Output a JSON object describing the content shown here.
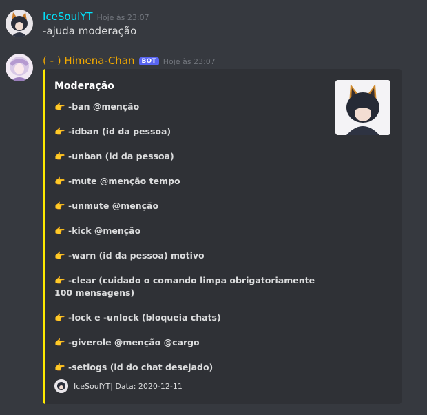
{
  "messages": [
    {
      "author": "IceSoulYT",
      "author_color": "#00e5ff",
      "timestamp": "Hoje às 23:07",
      "content": "-ajuda moderação"
    },
    {
      "author": "( - ) Himena-Chan",
      "author_color": "#f2a900",
      "badge": "BOT",
      "timestamp": "Hoje às 23:07",
      "embed": {
        "accent_color": "#ffea00",
        "title": "Moderação",
        "pointer_icon": "👉",
        "commands": [
          "-ban @menção",
          "-idban (id da pessoa)",
          "-unban (id da pessoa)",
          "-mute @menção tempo",
          "-unmute @menção",
          "-kick @menção",
          "-warn (id da pessoa) motivo",
          "-clear (cuidado o comando limpa obrigatoriamente 100 mensagens)",
          "-lock e -unlock (bloqueia chats)",
          "-giverole @menção @cargo",
          "-setlogs (id do chat desejado)"
        ],
        "footer": "IceSoulYT| Data: 2020-12-11"
      }
    }
  ]
}
